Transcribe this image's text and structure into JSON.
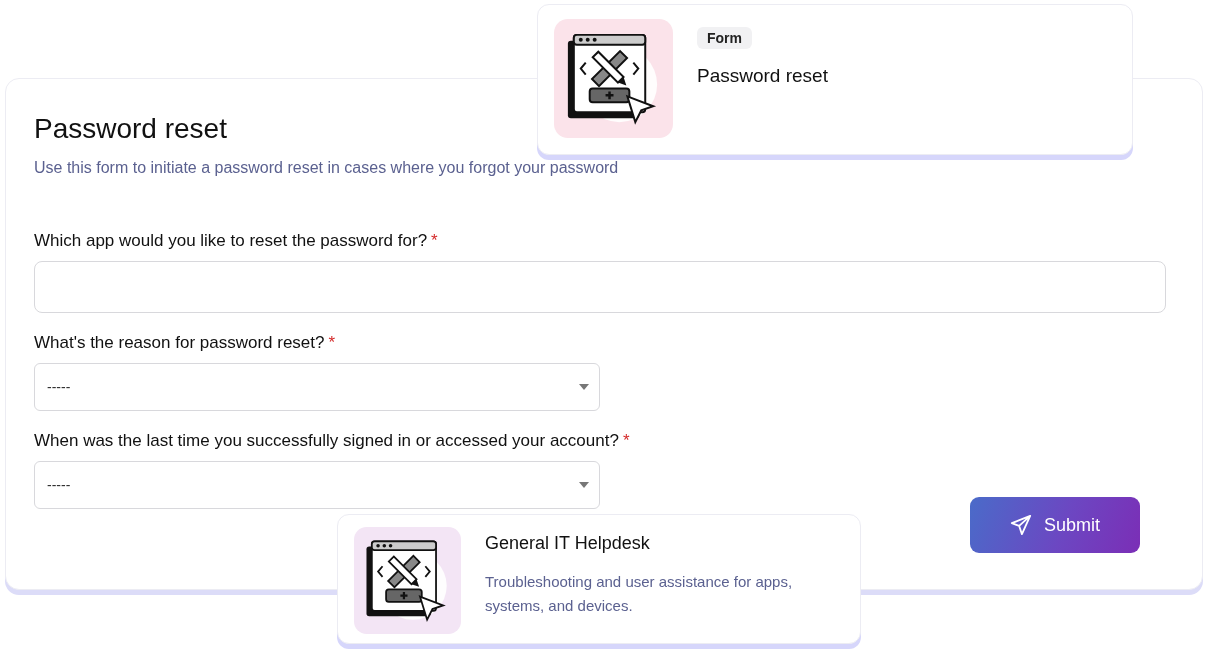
{
  "form": {
    "title": "Password reset",
    "description": "Use this form to initiate a password reset in cases where you forgot your password",
    "fields": [
      {
        "kind": "text",
        "label": "Which app would you like to reset the password for?",
        "required_mark": "*"
      },
      {
        "kind": "select",
        "label": "What's the reason for password reset?",
        "required_mark": "*",
        "value": "-----"
      },
      {
        "kind": "select",
        "label": "When was the last time you successfully signed in or accessed your account?",
        "required_mark": "*",
        "value": "-----"
      }
    ],
    "submit": "Submit"
  },
  "cards": [
    {
      "color": "#fbe3ea",
      "tag": "Form",
      "title": "Password reset"
    },
    {
      "color": "#f3e5f5",
      "title": "General IT Helpdesk",
      "description": "Troubleshooting and user assistance for apps, systems, and devices."
    }
  ]
}
